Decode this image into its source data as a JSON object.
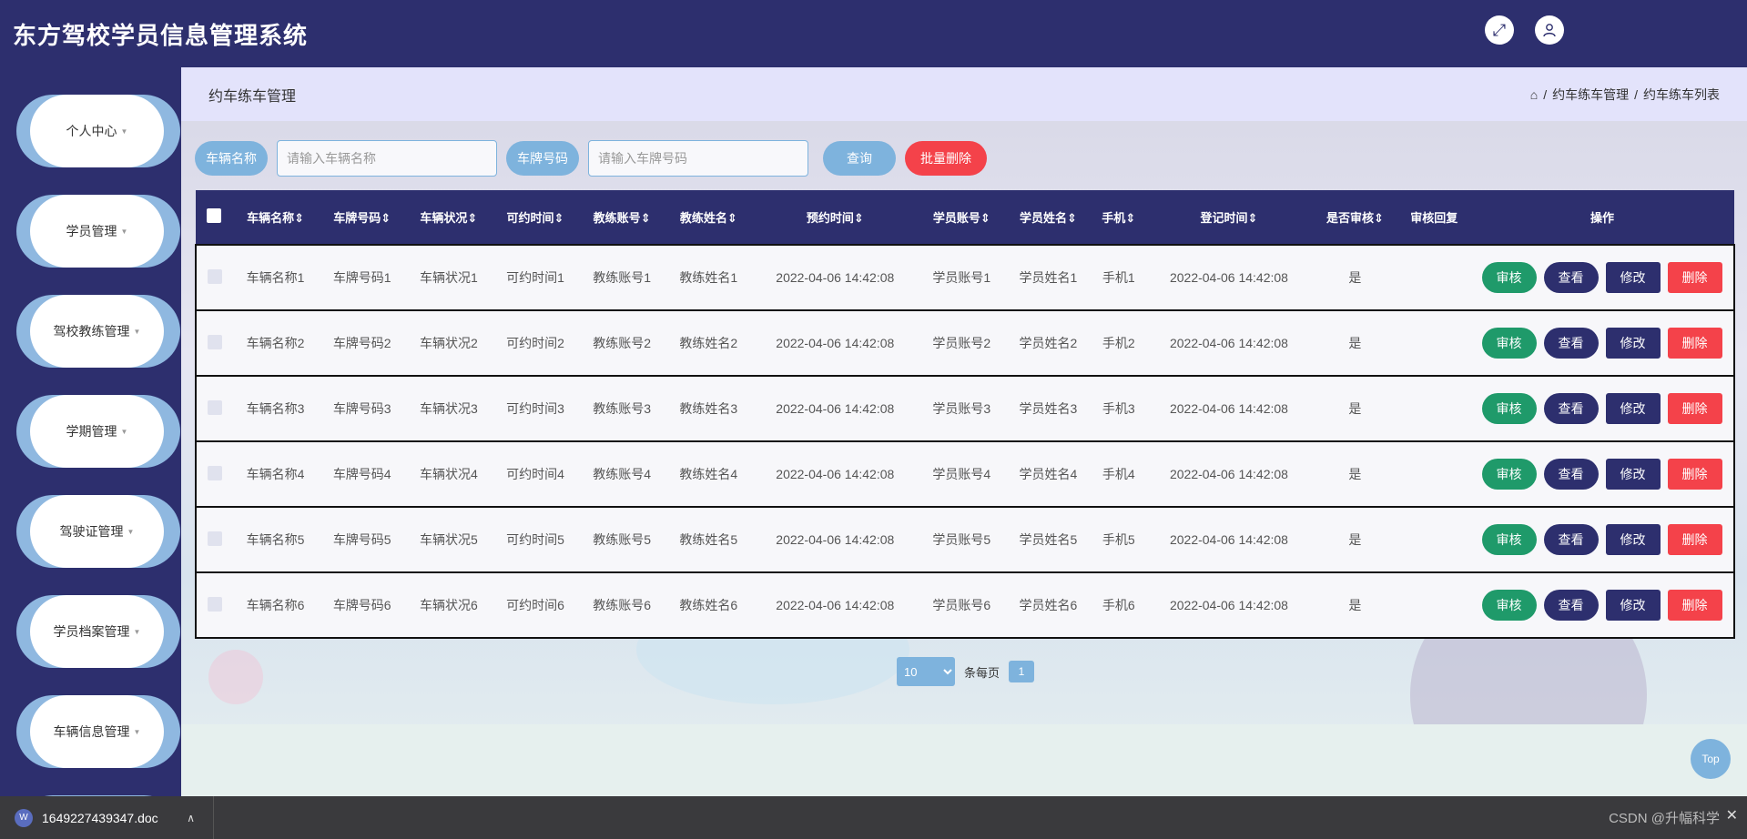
{
  "header": {
    "title": "东方驾校学员信息管理系统",
    "fullscreen_icon": "expand-icon",
    "user_icon": "user-icon"
  },
  "sidebar": {
    "items": [
      {
        "label": "个人中心"
      },
      {
        "label": "学员管理"
      },
      {
        "label": "驾校教练管理"
      },
      {
        "label": "学期管理"
      },
      {
        "label": "驾驶证管理"
      },
      {
        "label": "学员档案管理"
      },
      {
        "label": "车辆信息管理"
      }
    ]
  },
  "breadcrumb": {
    "page_title": "约车练车管理",
    "path": [
      "约车练车管理",
      "约车练车列表"
    ]
  },
  "search": {
    "vehicle_name_label": "车辆名称",
    "vehicle_name_placeholder": "请输入车辆名称",
    "plate_label": "车牌号码",
    "plate_placeholder": "请输入车牌号码",
    "query_label": "查询",
    "batch_delete_label": "批量删除"
  },
  "table": {
    "headers": [
      "车辆名称",
      "车牌号码",
      "车辆状况",
      "可约时间",
      "教练账号",
      "教练姓名",
      "预约时间",
      "学员账号",
      "学员姓名",
      "手机",
      "登记时间",
      "是否审核",
      "审核回复",
      "操作"
    ],
    "rows": [
      {
        "c": [
          "车辆名称1",
          "车牌号码1",
          "车辆状况1",
          "可约时间1",
          "教练账号1",
          "教练姓名1",
          "2022-04-06 14:42:08",
          "学员账号1",
          "学员姓名1",
          "手机1",
          "2022-04-06 14:42:08",
          "是",
          ""
        ]
      },
      {
        "c": [
          "车辆名称2",
          "车牌号码2",
          "车辆状况2",
          "可约时间2",
          "教练账号2",
          "教练姓名2",
          "2022-04-06 14:42:08",
          "学员账号2",
          "学员姓名2",
          "手机2",
          "2022-04-06 14:42:08",
          "是",
          ""
        ]
      },
      {
        "c": [
          "车辆名称3",
          "车牌号码3",
          "车辆状况3",
          "可约时间3",
          "教练账号3",
          "教练姓名3",
          "2022-04-06 14:42:08",
          "学员账号3",
          "学员姓名3",
          "手机3",
          "2022-04-06 14:42:08",
          "是",
          ""
        ]
      },
      {
        "c": [
          "车辆名称4",
          "车牌号码4",
          "车辆状况4",
          "可约时间4",
          "教练账号4",
          "教练姓名4",
          "2022-04-06 14:42:08",
          "学员账号4",
          "学员姓名4",
          "手机4",
          "2022-04-06 14:42:08",
          "是",
          ""
        ]
      },
      {
        "c": [
          "车辆名称5",
          "车牌号码5",
          "车辆状况5",
          "可约时间5",
          "教练账号5",
          "教练姓名5",
          "2022-04-06 14:42:08",
          "学员账号5",
          "学员姓名5",
          "手机5",
          "2022-04-06 14:42:08",
          "是",
          ""
        ]
      },
      {
        "c": [
          "车辆名称6",
          "车牌号码6",
          "车辆状况6",
          "可约时间6",
          "教练账号6",
          "教练姓名6",
          "2022-04-06 14:42:08",
          "学员账号6",
          "学员姓名6",
          "手机6",
          "2022-04-06 14:42:08",
          "是",
          ""
        ]
      }
    ],
    "actions": {
      "audit": "审核",
      "view": "查看",
      "edit": "修改",
      "delete": "删除"
    }
  },
  "pagination": {
    "page_size": "10",
    "page_size_label": "条每页",
    "current_page": "1"
  },
  "top_button": "Top",
  "download_bar": {
    "file_name": "1649227439347.doc"
  },
  "watermark": "CSDN @升幅科学",
  "colors": {
    "primary": "#2d2f6e",
    "accent": "#7eb3dd",
    "danger": "#f4424a",
    "success": "#1f9a6a"
  }
}
